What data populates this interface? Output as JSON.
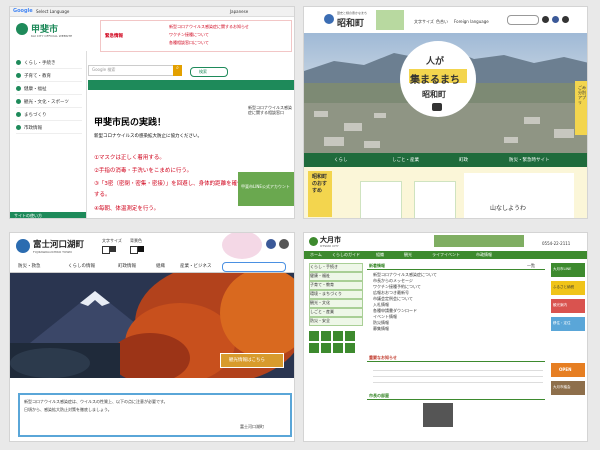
{
  "tile1": {
    "google_label": "Google",
    "translate_label": "Select Language",
    "lang_label": "Japanese",
    "logo": "甲斐市",
    "logo_sub": "KAI CITY OFFICIAL WEBSITE",
    "notice_label": "緊急情報",
    "notice_items": [
      "新型コロナウイルス感染症に関するお知らせ",
      "ワクチン接種について",
      "各種相談窓口について"
    ],
    "search_placeholder": "Google 検索",
    "search_button": "検索",
    "nav_items": [
      "くらし・手続き",
      "子育て・教育",
      "健康・福祉",
      "観光・文化・スポーツ",
      "まちづくり",
      "市政情報"
    ],
    "main_title": "甲斐市民の実践！",
    "main_sub": "新型コロナウイルスの感染拡大防止に協力ください。",
    "steps": [
      "①マスクは正しく着用する。",
      "②手指の消毒・手洗いをこまめに行う。",
      "③「3密（密閉・密集・密接）」を回避し、身体的距離を確保する。",
      "④毎朝、体温測定を行う。"
    ],
    "right_text": "新型コロナウイルス感染症に関する相談窓口",
    "banner_text": "甲斐市LINE公式アカウント",
    "bottom_link": "サイトの使い方"
  },
  "tile2": {
    "logo_small": "歴史と緑の豊かなまち",
    "logo": "昭和町",
    "header_links": [
      "文字サイズ",
      "色合い",
      "Foreign language"
    ],
    "hero_title_1": "人が",
    "hero_title_2": "集まるまち",
    "hero_title_3": "昭和町",
    "side_tab": "ごみ分別アプリ",
    "nav_items": [
      "くらし",
      "しごと・産業",
      "町政",
      "防災・緊急時サイト"
    ],
    "recommend": "昭和町のおすすめ",
    "bottom_text": "山なしようわ"
  },
  "tile3": {
    "logo": "富士河口湖町",
    "logo_sub": "FUJIKAWAGUCHIKO TOWN",
    "font_size": "文字サイズ",
    "color": "背景色",
    "nav_items": [
      "防災・救急",
      "くらしの情報",
      "町政情報",
      "組織",
      "産業・ビジネス"
    ],
    "photo_button": "観光情報はこちら",
    "notice_line1": "新型コロナウイルス感染症は、ウイルスの性質上、以下の点に注意が必要です。",
    "notice_line2": "日頃から、感染拡大防止対策を徹底しましょう。",
    "notice_link": "",
    "notice_bottom": "富士河口湖町"
  },
  "tile4": {
    "logo": "大月市",
    "logo_sub": "OTSUKI CITY",
    "phone": "0554-22-2111",
    "nav_items": [
      "ホーム",
      "くらしのガイド",
      "組織",
      "観光",
      "ライフイベント",
      "市政情報"
    ],
    "side_items": [
      "くらし・手続き",
      "健康・福祉",
      "子育て・教育",
      "環境・まちづくり",
      "観光・文化",
      "しごと・産業",
      "防災・安全"
    ],
    "news_title": "新着情報",
    "news_items": [
      "新型コロナウイルス感染症について",
      "市長からのメッセージ",
      "ワクチン接種予約について",
      "広報おおつき最新号",
      "市議会定例会について",
      "入札情報",
      "各種申請書ダウンロード",
      "イベント情報",
      "防災情報",
      "募集情報"
    ],
    "news_more": "一覧",
    "info_title": "重要なお知らせ",
    "mayor_title": "市長の部屋",
    "right_banners": [
      "大月市LINE",
      "ふるさと納税",
      "観光案内",
      "移住・定住",
      "OPEN",
      "大月市議会"
    ]
  }
}
